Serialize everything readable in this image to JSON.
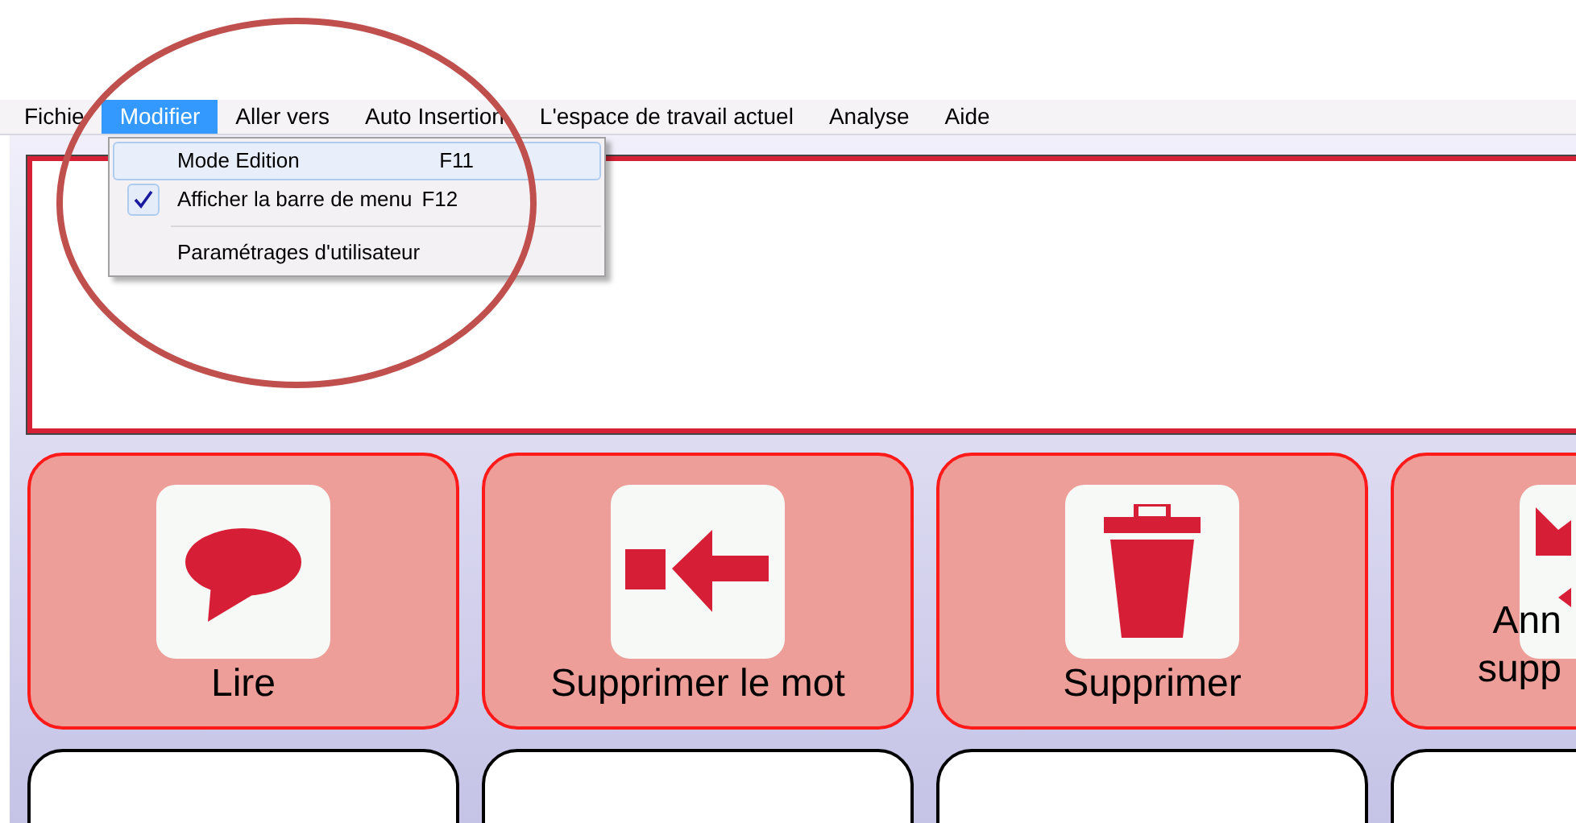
{
  "menu_bar": [
    {
      "label": "Fichie",
      "selected": false
    },
    {
      "label": "Modifier",
      "selected": true
    },
    {
      "label": "Aller vers",
      "selected": false
    },
    {
      "label": "Auto Insertion",
      "selected": false
    },
    {
      "label": "L'espace de travail actuel",
      "selected": false
    },
    {
      "label": "Analyse",
      "selected": false
    },
    {
      "label": "Aide",
      "selected": false
    }
  ],
  "dropdown": [
    {
      "kind": "item",
      "label": "Mode Edition",
      "shortcut": "F11",
      "highlighted": true,
      "checked": false
    },
    {
      "kind": "item",
      "label": "Afficher la barre de menu",
      "shortcut": "F12",
      "highlighted": false,
      "checked": true
    },
    {
      "kind": "separator"
    },
    {
      "kind": "item",
      "label": "Paramétrages d'utilisateur",
      "highlighted": false,
      "checked": false
    }
  ],
  "tiles": [
    {
      "kind": "speech",
      "lines": [
        "Lire"
      ]
    },
    {
      "kind": "backspace",
      "lines": [
        "Supprimer le mot"
      ]
    },
    {
      "kind": "trash",
      "lines": [
        "Supprimer"
      ]
    },
    {
      "kind": "undo",
      "lines": [
        "Ann",
        "supp"
      ]
    },
    {
      "kind": "blank"
    },
    {
      "kind": "blank"
    },
    {
      "kind": "blank"
    },
    {
      "kind": "blank"
    }
  ]
}
